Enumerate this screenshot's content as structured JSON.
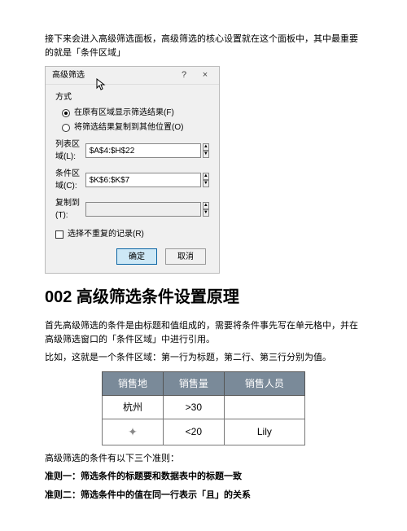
{
  "intro": "接下来会进入高级筛选面板，高级筛选的核心设置就在这个面板中，其中最重要的就是「条件区域」",
  "dialog": {
    "title": "高级筛选",
    "help": "?",
    "close": "×",
    "group": "方式",
    "radio1": "在原有区域显示筛选结果(F)",
    "radio2": "将筛选结果复制到其他位置(O)",
    "field1_label": "列表区域(L):",
    "field1_value": "$A$4:$H$22",
    "field2_label": "条件区域(C):",
    "field2_value": "$K$6:$K$7",
    "field3_label": "复制到(T):",
    "field3_value": "",
    "checkbox": "选择不重复的记录(R)",
    "ok": "确定",
    "cancel": "取消"
  },
  "heading": "002 高级筛选条件设置原理",
  "p1": "首先高级筛选的条件是由标题和值组成的，需要将条件事先写在单元格中，并在高级筛选窗口的「条件区域」中进行引用。",
  "p2": "比如，这就是一个条件区域：第一行为标题，第二行、第三行分别为值。",
  "table": {
    "h1": "销售地",
    "h2": "销售量",
    "h3": "销售人员",
    "r1c1": "杭州",
    "r1c2": ">30",
    "r1c3": "",
    "r2c1": "",
    "r2c2": "<20",
    "r2c3": "Lily"
  },
  "p3": "高级筛选的条件有以下三个准则：",
  "rule1": "准则一：筛选条件的标题要和数据表中的标题一致",
  "rule2": "准则二：筛选条件中的值在同一行表示「且」的关系"
}
